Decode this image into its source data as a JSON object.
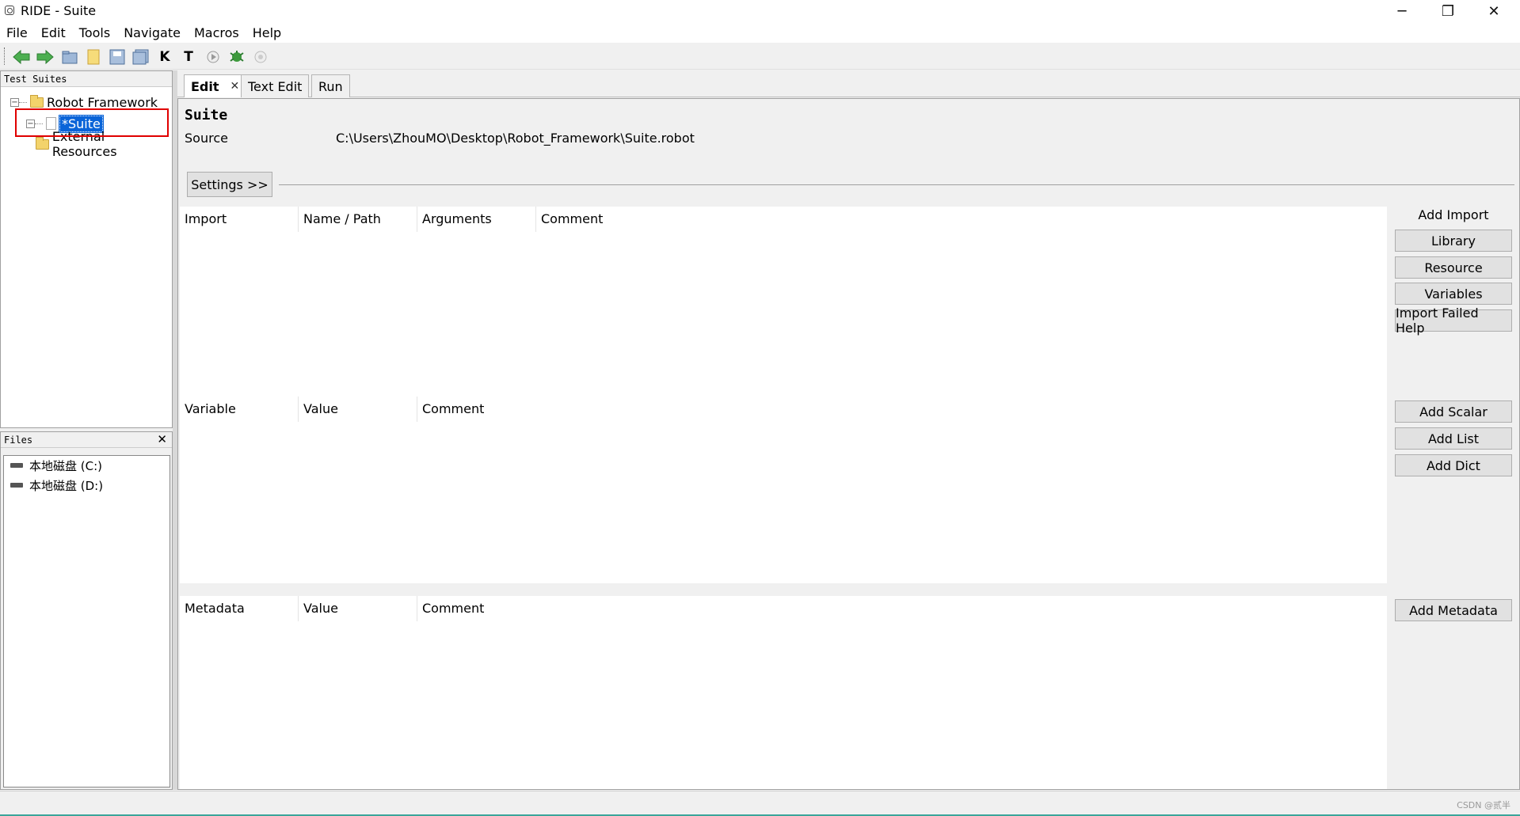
{
  "window": {
    "title": "RIDE - Suite",
    "minimize": "─",
    "maximize": "❐",
    "close": "✕"
  },
  "menu": [
    "File",
    "Edit",
    "Tools",
    "Navigate",
    "Macros",
    "Help"
  ],
  "toolbar_icons": [
    "back-arrow-icon",
    "forward-arrow-icon",
    "open-folder-icon",
    "new-folder-icon",
    "save-icon",
    "save-all-icon",
    "search-keywords-icon",
    "search-tests-icon",
    "run-icon",
    "debug-icon",
    "stop-icon"
  ],
  "test_suites_panel": {
    "caption": "Test Suites",
    "tree": {
      "root": "Robot Framework",
      "child": "*Suite",
      "external": "External Resources"
    }
  },
  "files_panel": {
    "caption": "Files",
    "drives": [
      "本地磁盘 (C:)",
      "本地磁盘 (D:)"
    ]
  },
  "tabs": [
    "Edit",
    "Text Edit",
    "Run"
  ],
  "editor": {
    "suite_name": "Suite",
    "source_label": "Source",
    "source_value": "C:\\Users\\ZhouMO\\Desktop\\Robot_Framework\\Suite.robot",
    "settings_button": "Settings >>",
    "import_headers": [
      "Import",
      "Name / Path",
      "Arguments",
      "Comment"
    ],
    "variable_headers": [
      "Variable",
      "Value",
      "Comment"
    ],
    "metadata_headers": [
      "Metadata",
      "Value",
      "Comment"
    ],
    "add_import_label": "Add Import",
    "import_buttons": [
      "Library",
      "Resource",
      "Variables",
      "Import Failed Help"
    ],
    "variable_buttons": [
      "Add Scalar",
      "Add List",
      "Add Dict"
    ],
    "metadata_button": "Add Metadata"
  },
  "status": {
    "watermark": "CSDN @贰半"
  }
}
